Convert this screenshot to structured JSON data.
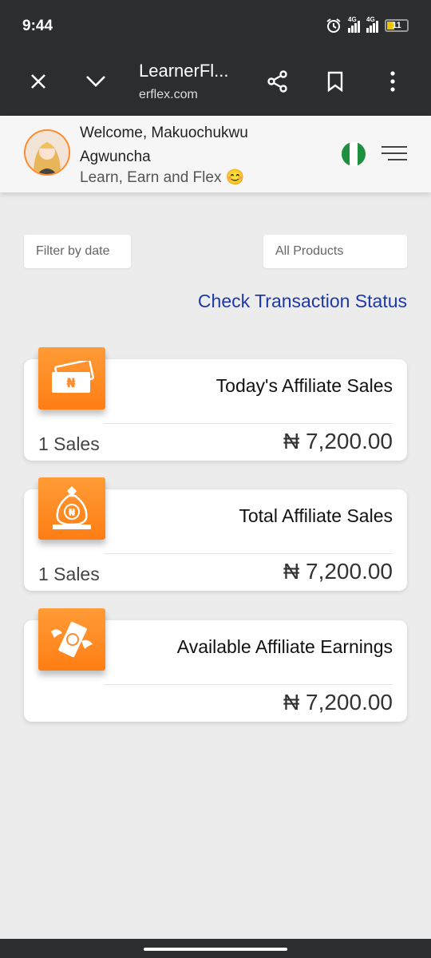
{
  "status_bar": {
    "time": "9:44",
    "network_1": "4G",
    "network_2": "4G",
    "battery": "11"
  },
  "browser": {
    "title": "LearnerFl...",
    "url": "erflex.com",
    "icons": [
      "close-icon",
      "chevron-down-icon",
      "share-icon",
      "bookmark-icon",
      "more-vert-icon"
    ]
  },
  "header": {
    "welcome": "Welcome, Makuochukwu Agwuncha",
    "tagline": "Learn, Earn and Flex 😊",
    "flag_colors": [
      "#1d8f3e",
      "#ffffff",
      "#1d8f3e"
    ]
  },
  "filters": {
    "date_placeholder": "Filter by date",
    "product_selected": "All Products"
  },
  "link": {
    "check_status": "Check Transaction Status"
  },
  "cards": [
    {
      "title": "Today's Affiliate Sales",
      "count": "1 Sales",
      "amount": "₦ 7,200.00",
      "icon": "cash-icon"
    },
    {
      "title": "Total Affiliate Sales",
      "count": "1 Sales",
      "amount": "₦ 7,200.00",
      "icon": "money-bag-icon"
    },
    {
      "title": "Available Affiliate Earnings",
      "count": "",
      "amount": "₦ 7,200.00",
      "icon": "flying-money-icon"
    }
  ],
  "colors": {
    "accent_orange": "#ff8a2a",
    "link_blue": "#1d39a8",
    "dark_bar": "#2b2d2f"
  }
}
